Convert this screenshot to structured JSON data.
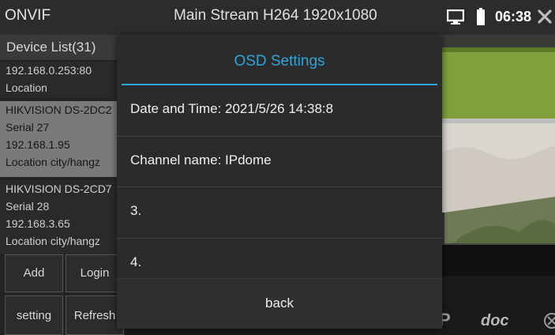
{
  "topbar": {
    "app_title": "ONVIF",
    "stream_title": "Main Stream H264 1920x1080",
    "clock": "06:38"
  },
  "device_list": {
    "title": "Device List(31)",
    "devices": [
      {
        "lines": [
          "192.168.0.253:80",
          "Location"
        ]
      },
      {
        "lines": [
          "HIKVISION DS-2DC2",
          "Serial 27",
          "192.168.1.95",
          "Location city/hangz"
        ]
      },
      {
        "lines": [
          "HIKVISION DS-2CD7",
          "Serial 28",
          "192.168.3.65",
          "Location city/hangz"
        ]
      }
    ],
    "buttons": {
      "add": "Add",
      "login": "Login",
      "setting": "setting",
      "refresh": "Refresh"
    }
  },
  "dialog": {
    "title": "OSD Settings",
    "rows": [
      "Date and Time: 2021/5/26 14:38:8",
      "Channel name: IPdome",
      "3.",
      "4."
    ],
    "back_label": "back"
  },
  "toolbar": {
    "doc_label": "doc",
    "p_label": "P"
  },
  "colors": {
    "accent": "#2aa6dc",
    "selected_row": "#7a7a7a"
  }
}
